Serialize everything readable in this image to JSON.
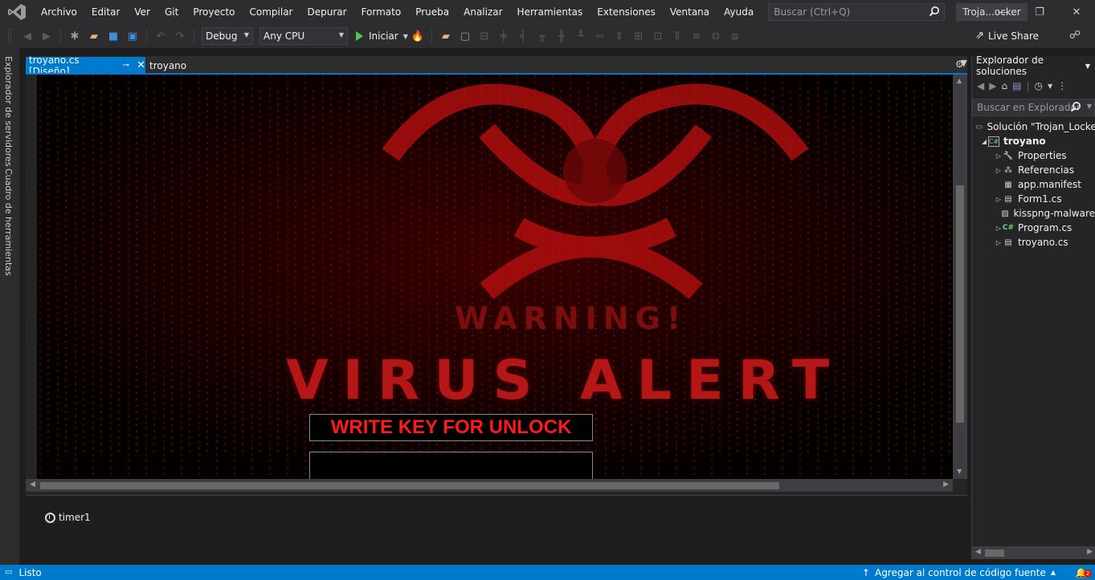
{
  "menubar": {
    "items": [
      "Archivo",
      "Editar",
      "Ver",
      "Git",
      "Proyecto",
      "Compilar",
      "Depurar",
      "Formato",
      "Prueba",
      "Analizar",
      "Herramientas",
      "Extensiones",
      "Ventana",
      "Ayuda"
    ],
    "search_placeholder": "Buscar (Ctrl+Q)",
    "solution_short_name": "Troja...ocker"
  },
  "toolbar": {
    "configuration": "Debug",
    "platform": "Any CPU",
    "start_label": "Iniciar",
    "live_share_label": "Live Share"
  },
  "left_tabs": {
    "server_explorer": "Explorador de servidores",
    "toolbox": "Cuadro de herramientas"
  },
  "doc_tabs": {
    "active": "troyano.cs [Diseño]",
    "second": "troyano"
  },
  "form": {
    "warning_text": "WARNING!",
    "virus_alert_text": "VIRUS ALERT",
    "key_label": "WRITE KEY FOR UNLOCK",
    "key_input_value": ""
  },
  "tray": {
    "component": "timer1"
  },
  "solution_explorer": {
    "title": "Explorador de soluciones",
    "search_placeholder": "Buscar en Explorador",
    "solution": "Solución \"Trojan_Locker\"",
    "project": "troyano",
    "items": [
      {
        "label": "Properties",
        "icon": "wrench-icon",
        "expandable": true
      },
      {
        "label": "Referencias",
        "icon": "references-icon",
        "expandable": true
      },
      {
        "label": "app.manifest",
        "icon": "manifest-icon",
        "expandable": false
      },
      {
        "label": "Form1.cs",
        "icon": "form-icon",
        "expandable": true
      },
      {
        "label": "kisspng-malware",
        "icon": "image-file-icon",
        "expandable": false
      },
      {
        "label": "Program.cs",
        "icon": "csharp-file-icon",
        "expandable": true
      },
      {
        "label": "troyano.cs",
        "icon": "form-icon",
        "expandable": true
      }
    ]
  },
  "statusbar": {
    "status": "Listo",
    "source_control": "Agregar al control de código fuente",
    "notifications": "2"
  },
  "colors": {
    "accent": "#007acc",
    "chrome": "#2d2d30",
    "alert_red": "#ff1a1a"
  }
}
